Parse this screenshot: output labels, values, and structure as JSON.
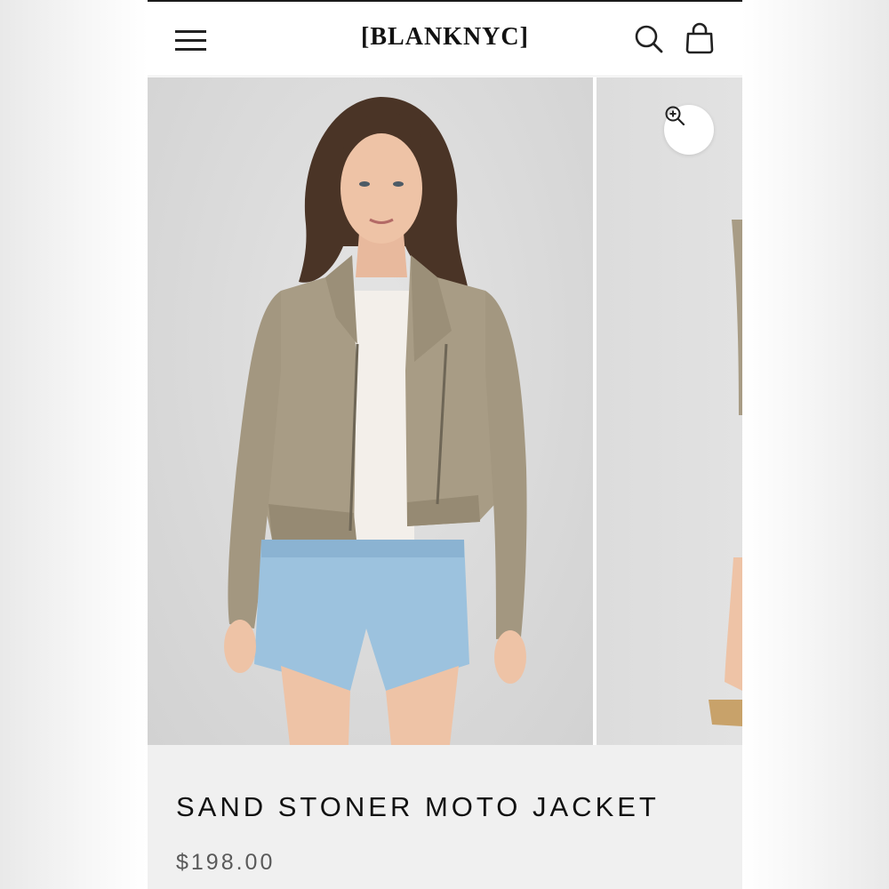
{
  "header": {
    "brand": "[BLANKNYC]",
    "menu_icon": "hamburger-menu-icon",
    "search_icon": "search-icon",
    "cart_icon": "shopping-bag-icon"
  },
  "gallery": {
    "zoom_icon": "zoom-in-icon",
    "background_color": "#d9d9d9"
  },
  "product": {
    "title": "SAND STONER MOTO JACKET",
    "price": "$198.00"
  },
  "colors": {
    "jacket": "#a89c85",
    "denim": "#9cc2de",
    "text": "#111111",
    "price_text": "#5a5a5a",
    "info_bg": "#f0f0f0"
  }
}
